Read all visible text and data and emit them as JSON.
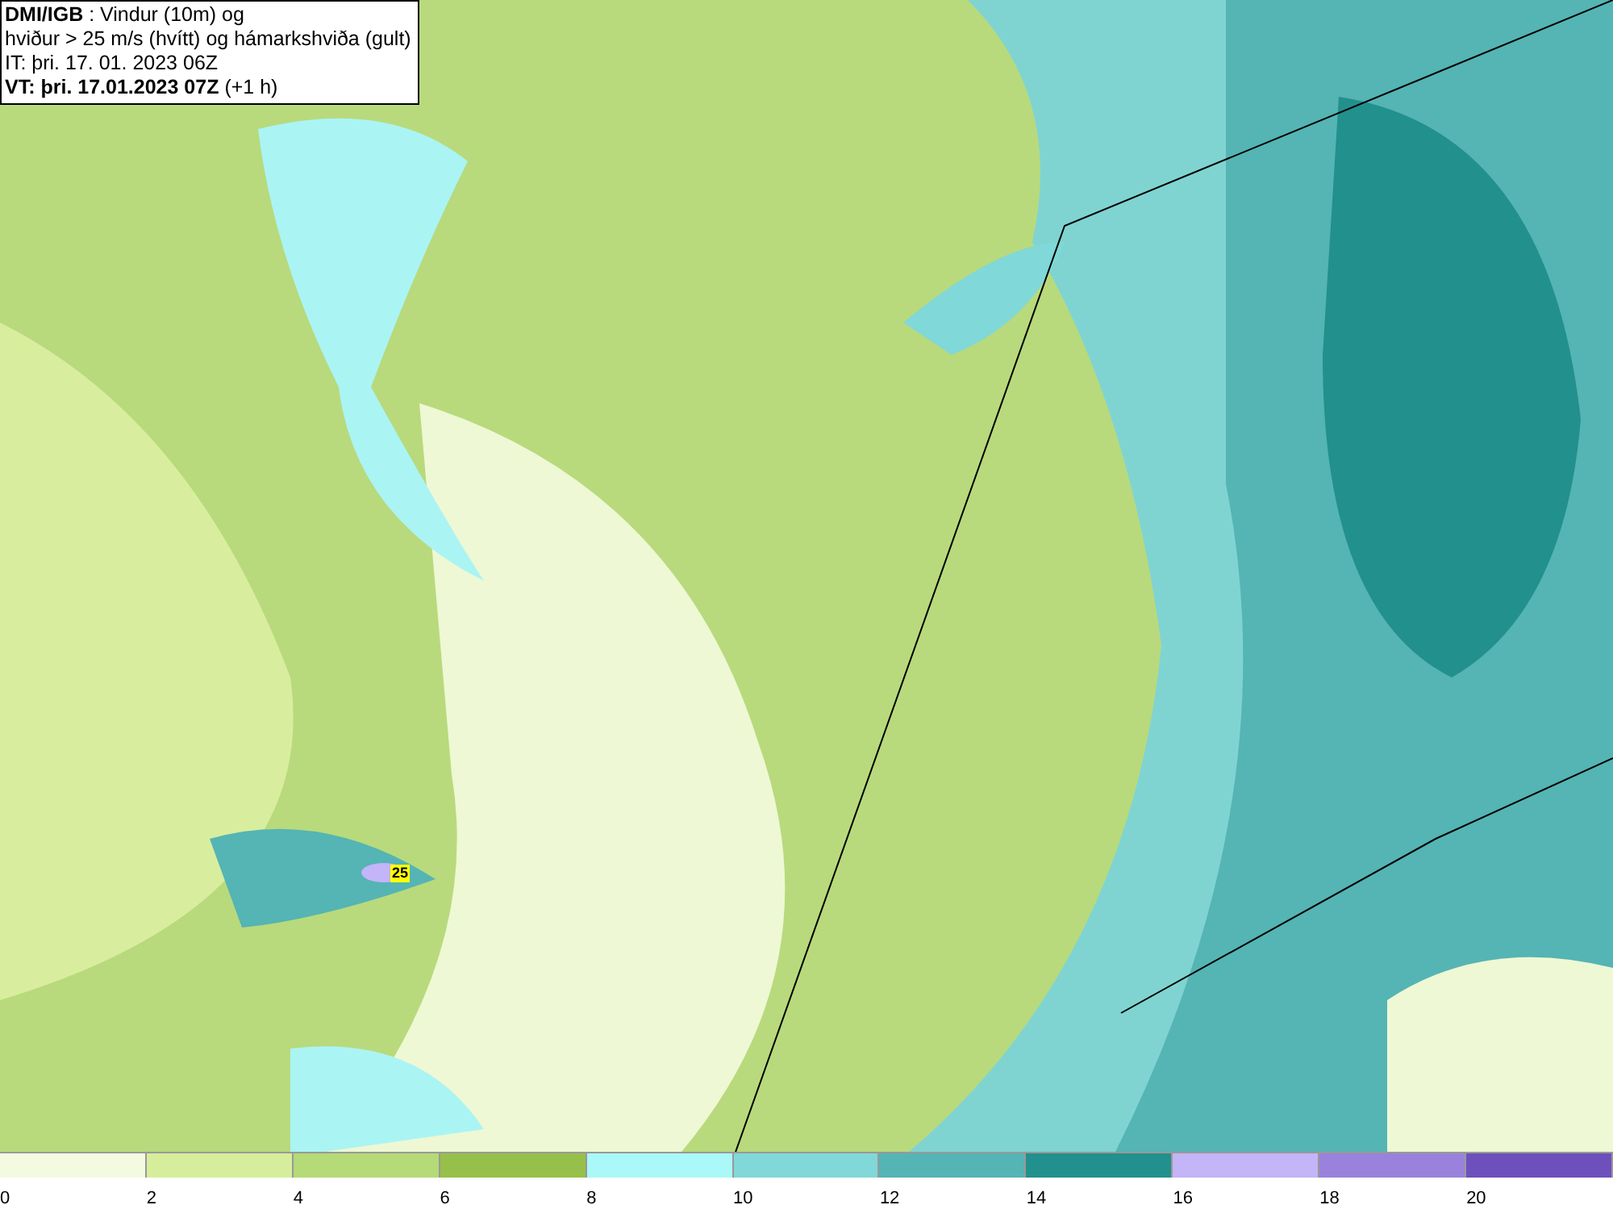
{
  "header": {
    "lines": [
      "**DMI/IGB** : Vindur (10m) og",
      "hviður > 25 m/s (hvítt) og hámarkshviða (gult)",
      "IT: þri. 17. 01. 2023 06Z",
      "**VT: þri. 17.01.2023 07Z** (+1 h)"
    ]
  },
  "map": {
    "gust_marker": {
      "text": "25"
    }
  },
  "legend": {
    "bins": [
      {
        "label": "0",
        "color": "#f4fae0"
      },
      {
        "label": "2",
        "color": "#d6ee9c"
      },
      {
        "label": "4",
        "color": "#b5da78"
      },
      {
        "label": "6",
        "color": "#97c04a"
      },
      {
        "label": "8",
        "color": "#aaf8f8"
      },
      {
        "label": "10",
        "color": "#80d8d8"
      },
      {
        "label": "12",
        "color": "#55b4b4"
      },
      {
        "label": "14",
        "color": "#22908c"
      },
      {
        "label": "16",
        "color": "#c4b4f8"
      },
      {
        "label": "18",
        "color": "#9a82dc"
      },
      {
        "label": "20",
        "color": "#6e50bc"
      }
    ]
  }
}
